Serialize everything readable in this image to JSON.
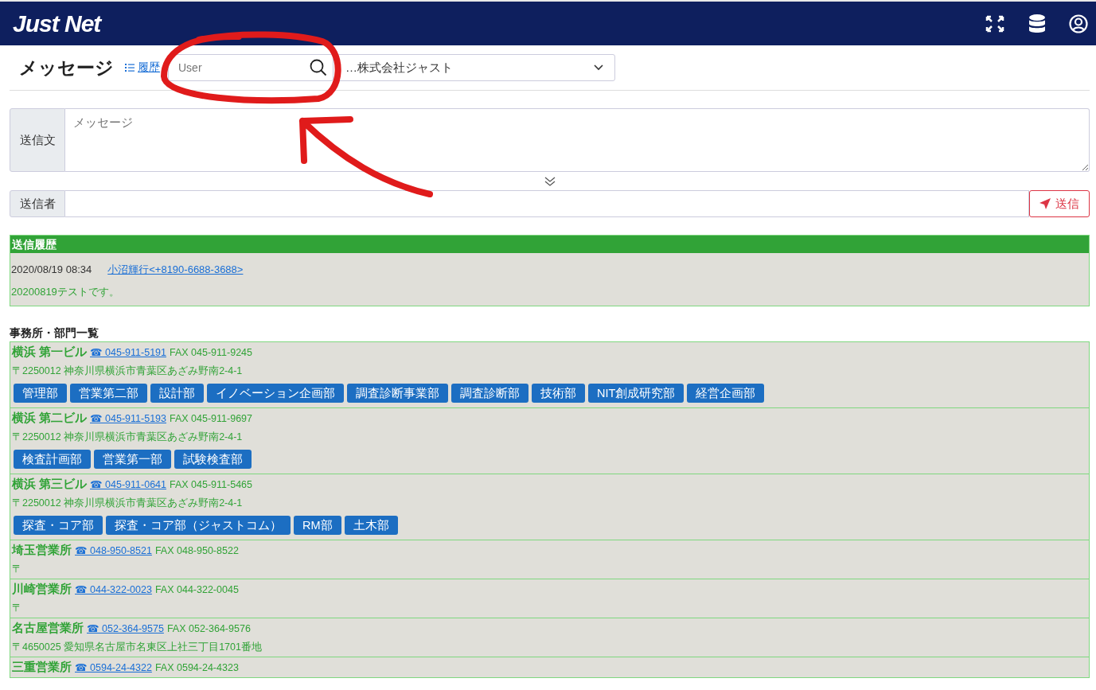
{
  "header": {
    "logo": "Just Net"
  },
  "page": {
    "title": "メッセージ",
    "history_link": "履歴",
    "search": {
      "placeholder": "User"
    },
    "company_select": {
      "value": "…株式会社ジャスト"
    }
  },
  "message_form": {
    "body_label": "送信文",
    "body_placeholder": "メッセージ",
    "sender_label": "送信者",
    "send_button": "送信"
  },
  "history": {
    "title": "送信履歴",
    "entries": [
      {
        "time": "2020/08/19 08:34",
        "sender": "小沼輝行<+8190-6688-3688>",
        "text": "20200819テストです。"
      }
    ]
  },
  "offices": {
    "title": "事務所・部門一覧",
    "items": [
      {
        "name": "横浜 第一ビル",
        "phone": "☎ 045-911-5191",
        "fax": "FAX 045-911-9245",
        "address": "〒2250012 神奈川県横浜市青葉区あざみ野南2-4-1",
        "departments": [
          "管理部",
          "営業第二部",
          "設計部",
          "イノベーション企画部",
          "調査診断事業部",
          "調査診断部",
          "技術部",
          "NIT創成研究部",
          "経営企画部"
        ]
      },
      {
        "name": "横浜 第二ビル",
        "phone": "☎ 045-911-5193",
        "fax": "FAX 045-911-9697",
        "address": "〒2250012 神奈川県横浜市青葉区あざみ野南2-4-1",
        "departments": [
          "検査計画部",
          "営業第一部",
          "試験検査部"
        ]
      },
      {
        "name": "横浜 第三ビル",
        "phone": "☎ 045-911-0641",
        "fax": "FAX 045-911-5465",
        "address": "〒2250012 神奈川県横浜市青葉区あざみ野南2-4-1",
        "departments": [
          "探査・コア部",
          "探査・コア部（ジャストコム）",
          "RM部",
          "土木部"
        ]
      },
      {
        "name": "埼玉営業所",
        "phone": "☎ 048-950-8521",
        "fax": "FAX 048-950-8522",
        "address": "〒"
      },
      {
        "name": "川崎営業所",
        "phone": "☎ 044-322-0023",
        "fax": "FAX 044-322-0045",
        "address": "〒"
      },
      {
        "name": "名古屋営業所",
        "phone": "☎ 052-364-9575",
        "fax": "FAX 052-364-9576",
        "address": "〒4650025 愛知県名古屋市名東区上社三丁目1701番地"
      },
      {
        "name": "三重営業所",
        "phone": "☎ 0594-24-4322",
        "fax": "FAX 0594-24-4323"
      }
    ]
  }
}
